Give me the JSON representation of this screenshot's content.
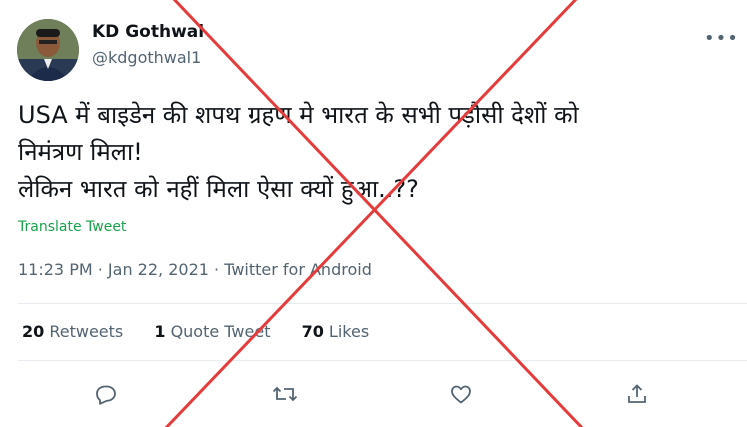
{
  "user": {
    "display_name": "KD Gothwal",
    "handle": "@kdgothwal1"
  },
  "more_label": "•••",
  "tweet": {
    "lines": [
      "USA में बाइडेन की शपथ ग्रहण मे भारत के सभी पड़ौसी देशों को",
      "निमंत्रण मिला!",
      "लेकिन भारत को नहीं मिला ऐसा क्यों हुआ..??"
    ],
    "translate_label": "Translate Tweet"
  },
  "meta": {
    "time": "11:23 PM",
    "sep1": " · ",
    "date": "Jan 22, 2021",
    "sep2": " · ",
    "source": "Twitter for Android"
  },
  "stats": {
    "retweets_count": "20",
    "retweets_label": " Retweets",
    "quotes_count": "1",
    "quotes_label": " Quote Tweet",
    "likes_count": "70",
    "likes_label": " Likes"
  },
  "icons": {
    "reply": "reply-icon",
    "retweet": "retweet-icon",
    "like": "heart-icon",
    "share": "share-icon"
  },
  "colors": {
    "cross": "#e63b3b",
    "translate": "#17a34a",
    "secondary": "#536471"
  }
}
